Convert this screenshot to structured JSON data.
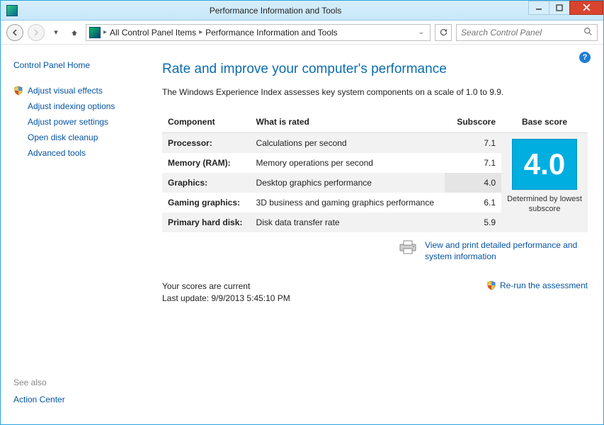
{
  "window": {
    "title": "Performance Information and Tools",
    "search_placeholder": "Search Control Panel"
  },
  "breadcrumb": {
    "item1": "All Control Panel Items",
    "item2": "Performance Information and Tools"
  },
  "sidebar": {
    "home": "Control Panel Home",
    "tasks": [
      "Adjust visual effects",
      "Adjust indexing options",
      "Adjust power settings",
      "Open disk cleanup",
      "Advanced tools"
    ],
    "see_also_label": "See also",
    "see_also_link": "Action Center"
  },
  "main": {
    "title": "Rate and improve your computer's performance",
    "intro": "The Windows Experience Index assesses key system components on a scale of 1.0 to 9.9.",
    "headers": {
      "component": "Component",
      "rated": "What is rated",
      "subscore": "Subscore",
      "base": "Base score"
    },
    "rows": [
      {
        "component": "Processor:",
        "rated": "Calculations per second",
        "sub": "7.1"
      },
      {
        "component": "Memory (RAM):",
        "rated": "Memory operations per second",
        "sub": "7.1"
      },
      {
        "component": "Graphics:",
        "rated": "Desktop graphics performance",
        "sub": "4.0",
        "lowest": true
      },
      {
        "component": "Gaming graphics:",
        "rated": "3D business and gaming graphics performance",
        "sub": "6.1"
      },
      {
        "component": "Primary hard disk:",
        "rated": "Disk data transfer rate",
        "sub": "5.9"
      }
    ],
    "base_score": "4.0",
    "base_caption": "Determined by lowest subscore",
    "detail_link": "View and print detailed performance and system information",
    "status_current": "Your scores are current",
    "status_updated": "Last update: 9/9/2013 5:45:10 PM",
    "rerun": "Re-run the assessment"
  }
}
